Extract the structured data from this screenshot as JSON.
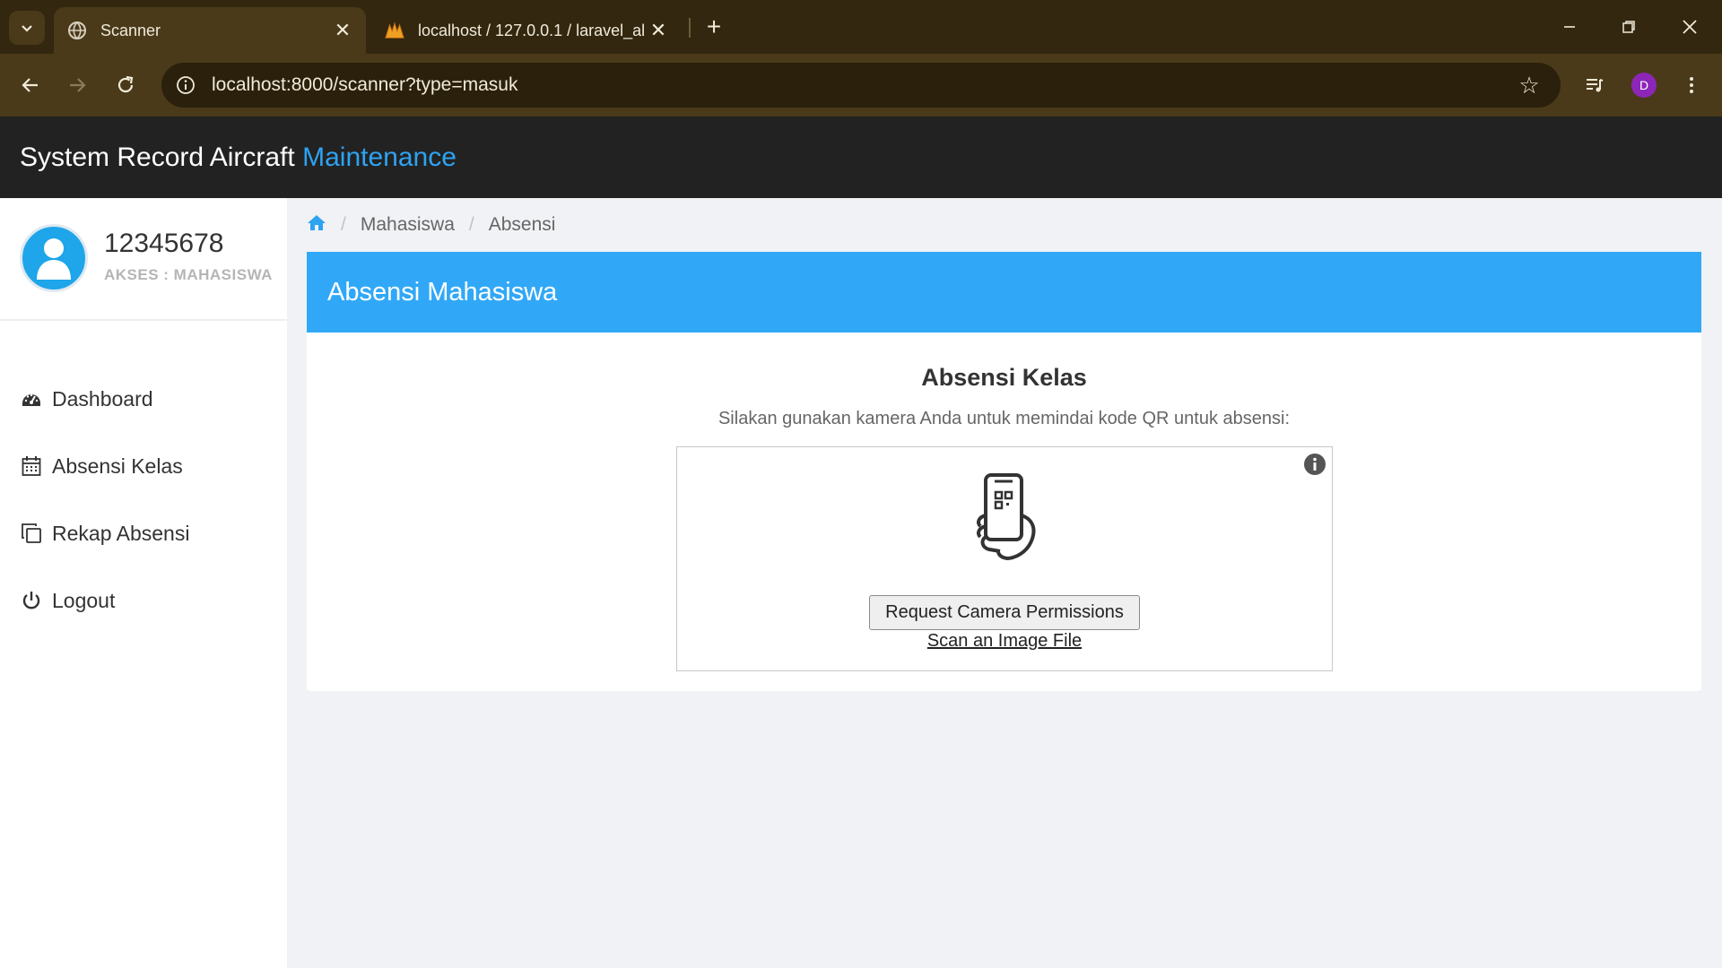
{
  "browser": {
    "tabs": [
      {
        "title": "Scanner",
        "active": true
      },
      {
        "title": "localhost / 127.0.0.1 / laravel_al",
        "active": false
      }
    ],
    "url": "localhost:8000/scanner?type=masuk",
    "profile_initial": "D"
  },
  "header": {
    "brand_main": "System Record Aircraft",
    "brand_accent": "Maintenance"
  },
  "sidebar": {
    "user_id": "12345678",
    "user_role": "AKSES : MAHASISWA",
    "items": [
      {
        "label": "Dashboard",
        "icon": "dashboard-icon"
      },
      {
        "label": "Absensi Kelas",
        "icon": "calendar-icon"
      },
      {
        "label": "Rekap Absensi",
        "icon": "copy-icon"
      },
      {
        "label": "Logout",
        "icon": "power-icon"
      }
    ]
  },
  "breadcrumb": {
    "items": [
      "Mahasiswa",
      "Absensi"
    ]
  },
  "card": {
    "title": "Absensi Mahasiswa",
    "section_title": "Absensi Kelas",
    "section_desc": "Silakan gunakan kamera Anda untuk memindai kode QR untuk absensi:",
    "request_button": "Request Camera Permissions",
    "scan_link": "Scan an Image File"
  },
  "colors": {
    "accent": "#2ea3f2",
    "card_header": "#31a8f7",
    "app_header": "#222222",
    "browser_frame": "#33270f"
  }
}
